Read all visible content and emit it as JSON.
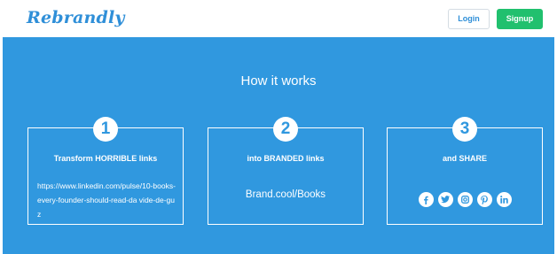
{
  "header": {
    "logo": "Rebrandly",
    "login_label": "Login",
    "signup_label": "Signup"
  },
  "main": {
    "title": "How it works",
    "cards": [
      {
        "number": "1",
        "heading": "Transform HORRIBLE links",
        "body": "https://www.linkedin.com/pulse/10-books-every-founder-should-read-da vide-de-guz"
      },
      {
        "number": "2",
        "heading": "into BRANDED links",
        "body": "Brand.cool/Books"
      },
      {
        "number": "3",
        "heading": "and SHARE"
      }
    ],
    "social_icons": [
      "facebook-icon",
      "twitter-icon",
      "instagram-icon",
      "pinterest-icon",
      "linkedin-icon"
    ]
  },
  "colors": {
    "brand_blue": "#3098df",
    "logo_blue": "#2f8fd8",
    "signup_green": "#21c06e"
  }
}
